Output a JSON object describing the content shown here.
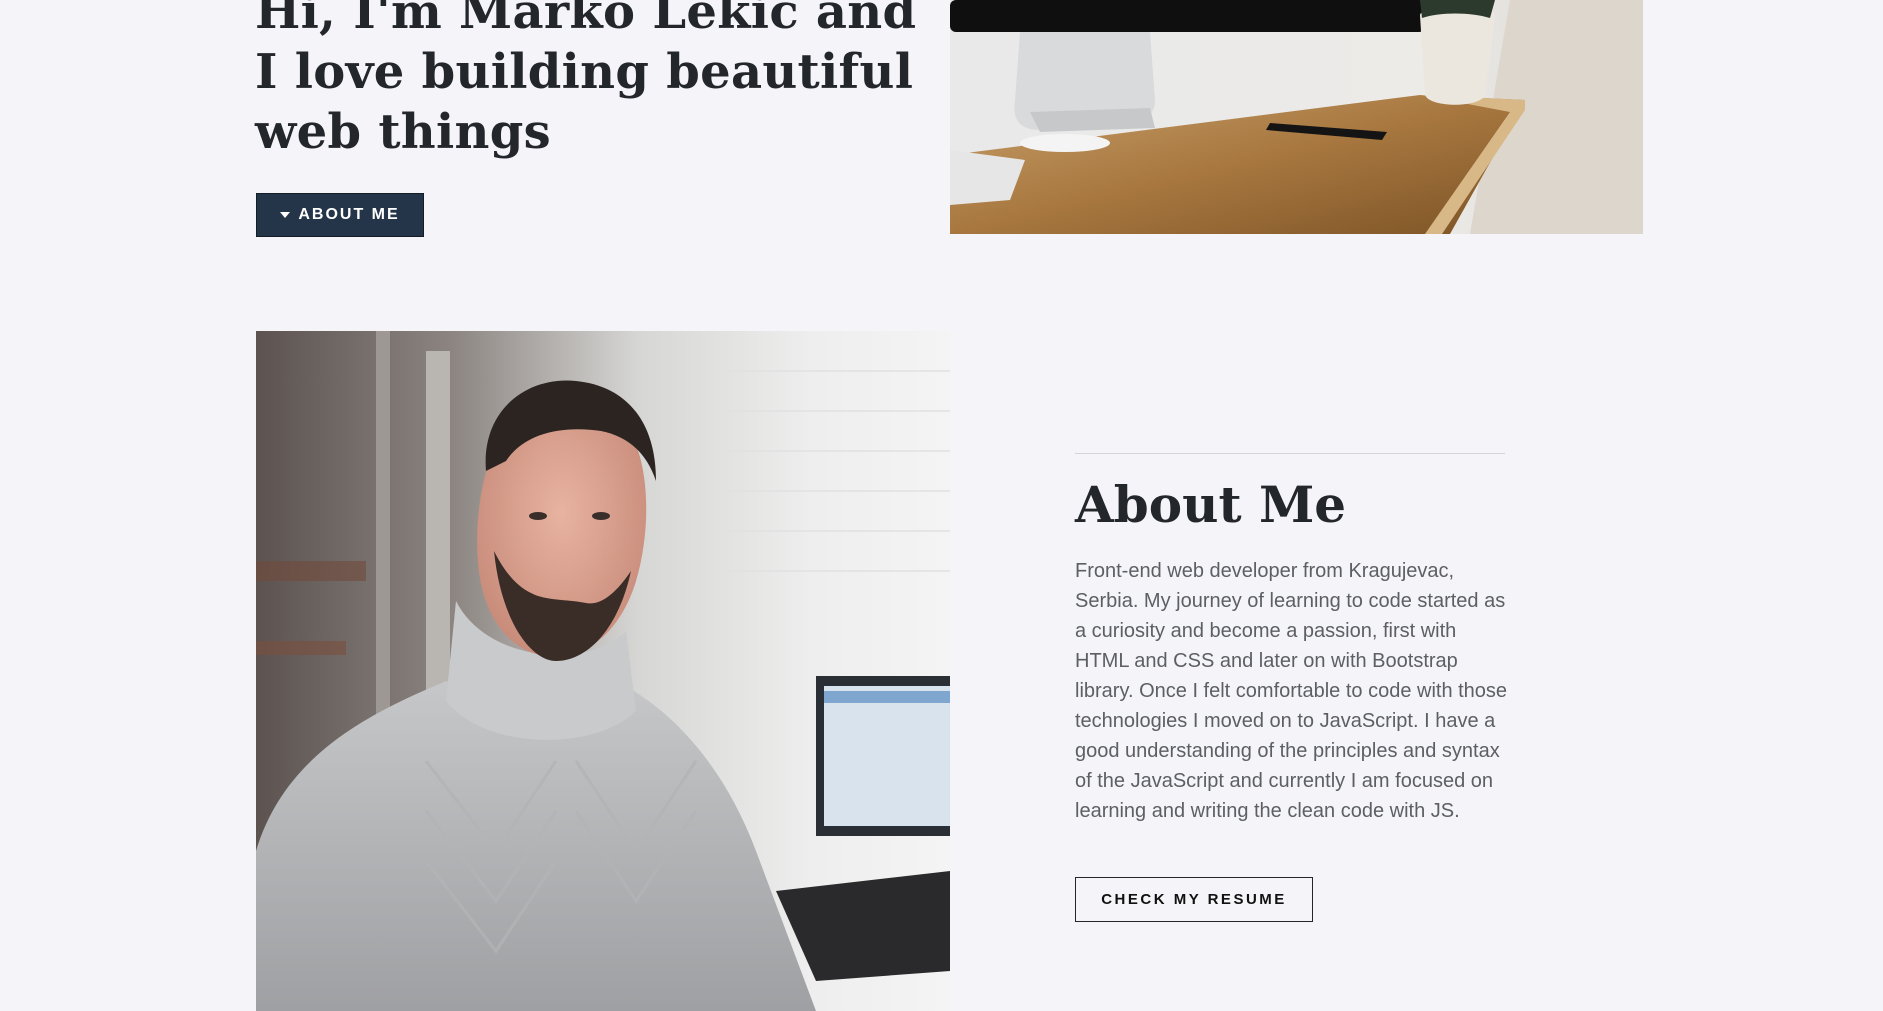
{
  "hero": {
    "title": "Hi, I'm Marko Lekic and I love building beautiful web things",
    "about_button_label": "ABOUT ME",
    "about_button_icon": "caret-down-icon"
  },
  "about": {
    "title": "About Me",
    "description": "Front-end web developer from Kragujevac, Serbia. My journey of learning to code started as a curiosity and become a passion, first with HTML and CSS and later on with Bootstrap library. Once I felt comfortable to code with those technologies I moved on to JavaScript. I have a good understanding of the principles and syntax of the JavaScript and currently I am focused on learning and writing the clean code with JS.",
    "resume_button_label": "CHECK MY RESUME"
  },
  "colors": {
    "background": "#f5f4f8",
    "primary_button": "#24354a",
    "heading_text": "#23272b",
    "body_text": "#5c5f63"
  }
}
